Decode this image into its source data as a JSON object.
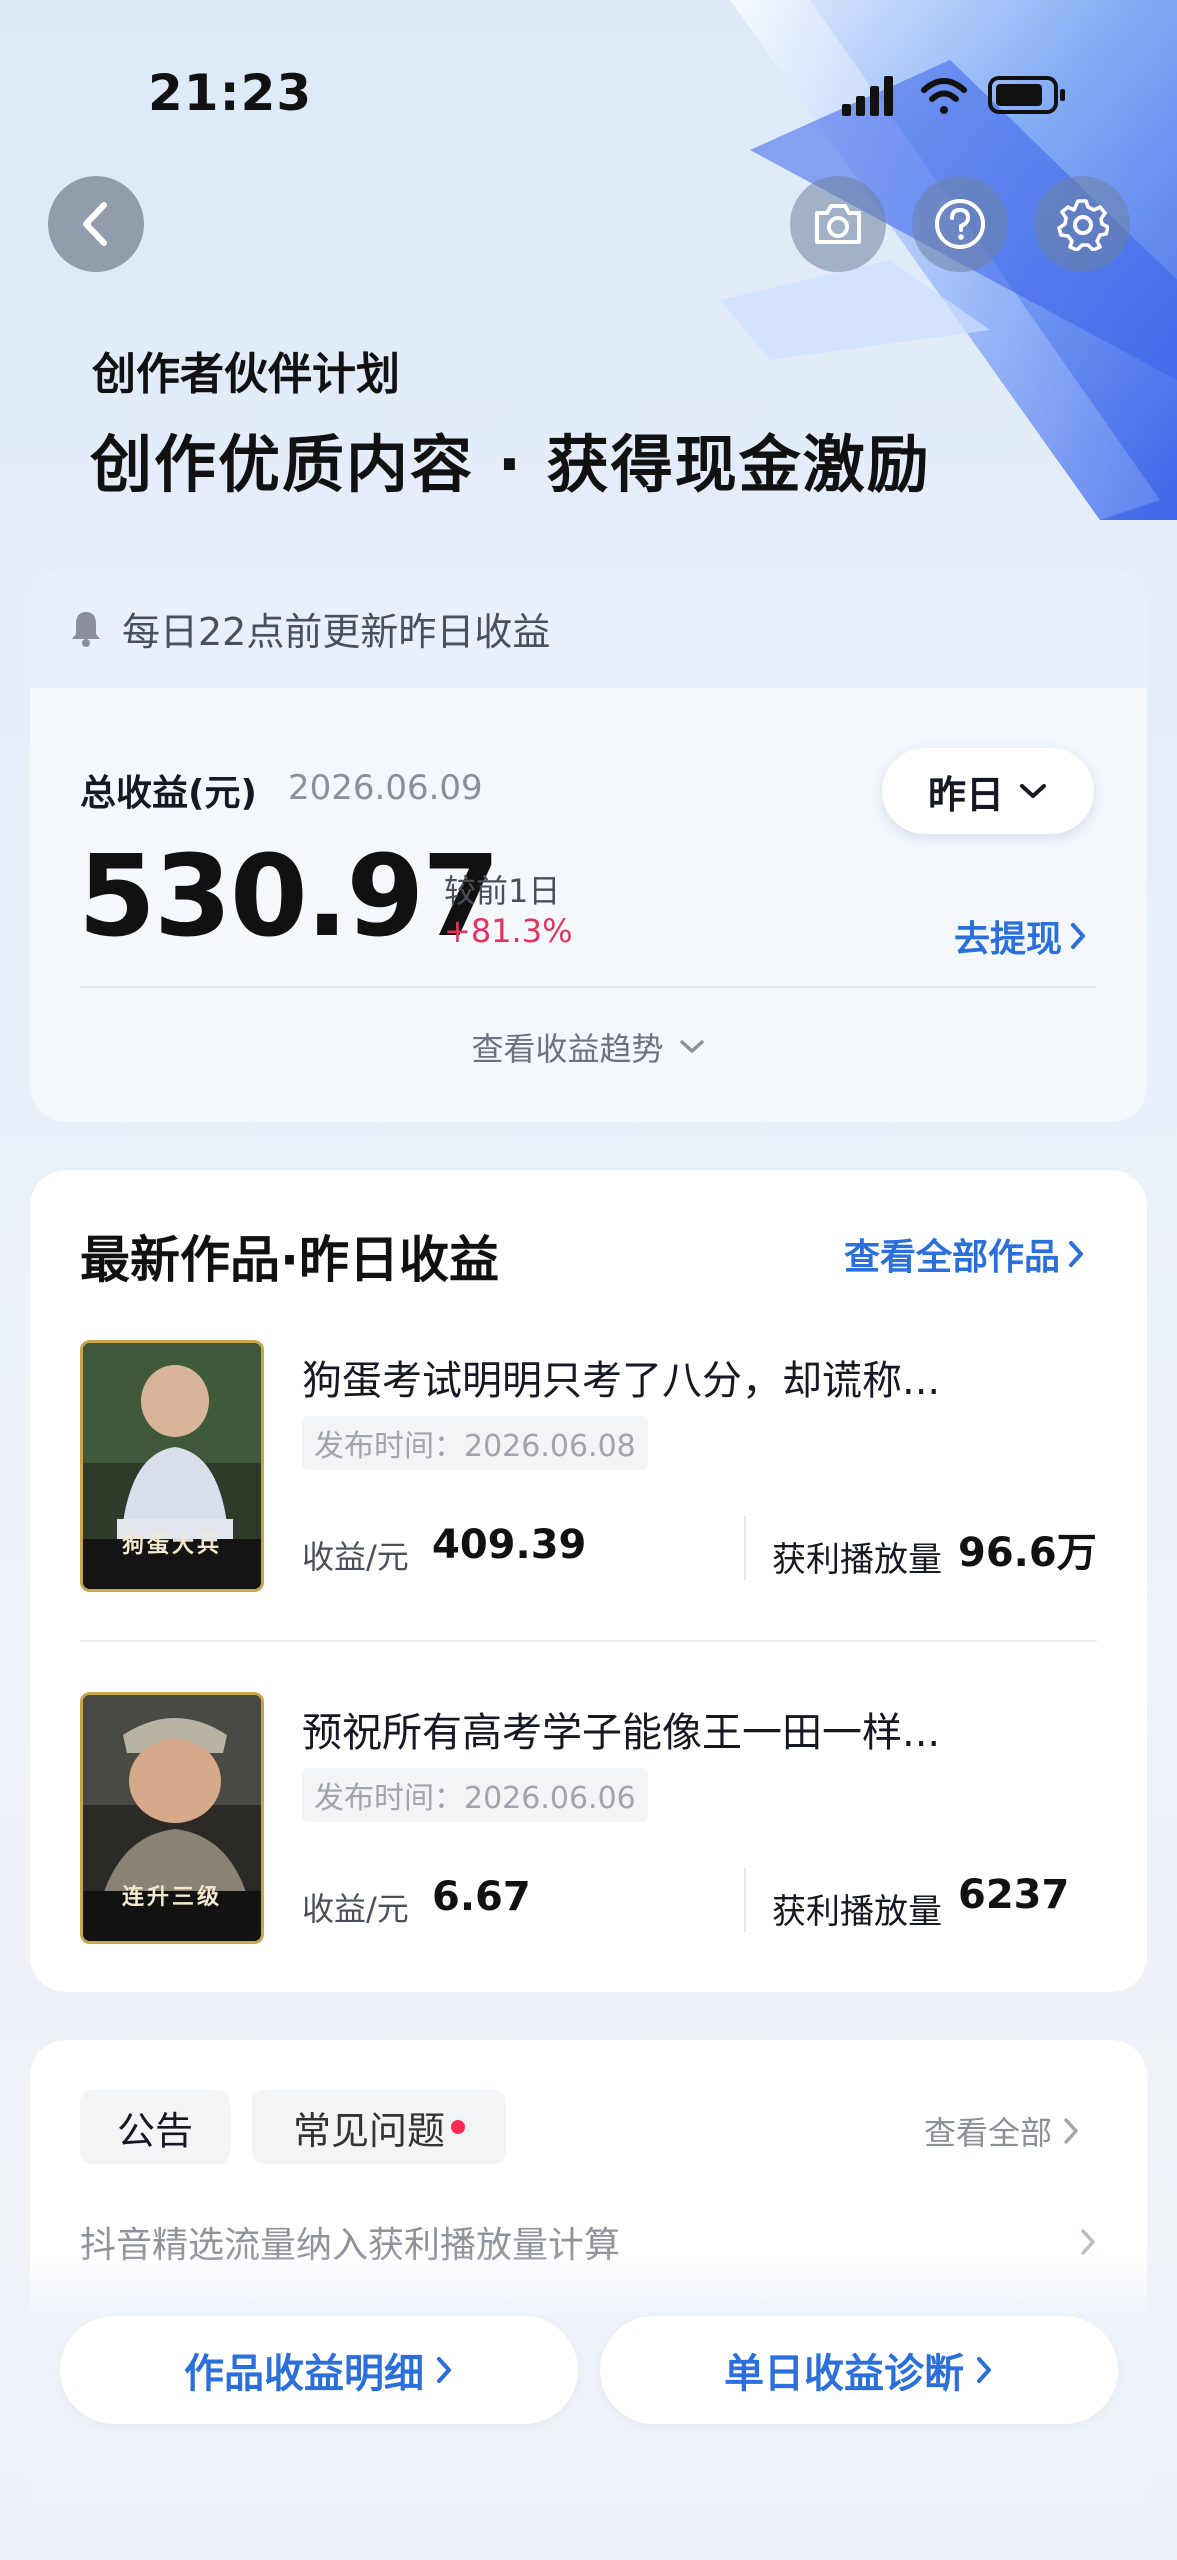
{
  "status_bar": {
    "time": "21:23"
  },
  "header": {
    "program_name": "创作者伙伴计划",
    "slogan": "创作优质内容 · 获得现金激励"
  },
  "earnings": {
    "notice": "每日22点前更新昨日收益",
    "total_label": "总收益(元)",
    "date": "2026.06.09",
    "period": "昨日",
    "amount": "530.97",
    "compare_label": "较前1日",
    "compare_value": "+81.3%",
    "withdraw": "去提现",
    "trend": "查看收益趋势"
  },
  "works": {
    "title": "最新作品·昨日收益",
    "view_all": "查看全部作品",
    "items": [
      {
        "thumb_caption": "狗蛋大兵",
        "title": "狗蛋考试明明只考了八分，却谎称...",
        "published": "发布时间：2026.06.08",
        "revenue_label": "收益/元",
        "revenue": "409.39",
        "plays_label": "获利播放量",
        "plays": "96.6万"
      },
      {
        "thumb_caption": "连升三级",
        "title": "预祝所有高考学子能像王一田一样...",
        "published": "发布时间：2026.06.06",
        "revenue_label": "收益/元",
        "revenue": "6.67",
        "plays_label": "获利播放量",
        "plays": "6237"
      }
    ]
  },
  "notices": {
    "tabs": [
      "公告",
      "常见问题"
    ],
    "view_all": "查看全部",
    "first_item": "抖音精选流量纳入获利播放量计算"
  },
  "bottom_buttons": {
    "detail": "作品收益明细",
    "diagnosis": "单日收益诊断"
  },
  "colors": {
    "accent": "#2a6fdb",
    "up": "#e5335b",
    "badge": "#fe2c55"
  }
}
